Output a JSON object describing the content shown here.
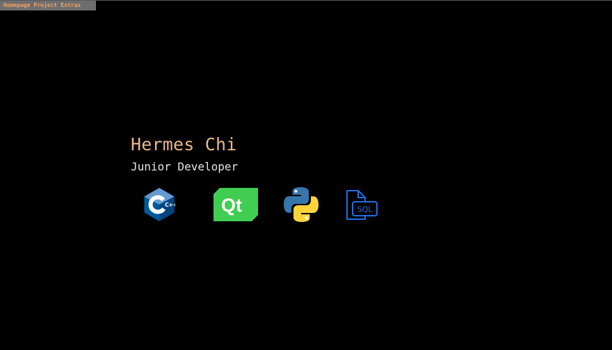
{
  "nav": {
    "items": [
      {
        "label": "Homepage"
      },
      {
        "label": "Project"
      },
      {
        "label": "Extras"
      }
    ]
  },
  "profile": {
    "name": "Hermes Chi",
    "role": "Junior Developer"
  },
  "skills": [
    {
      "icon": "cpp-icon",
      "text": "C++"
    },
    {
      "icon": "qt-icon",
      "text": "Qt"
    },
    {
      "icon": "python-icon",
      "text": ""
    },
    {
      "icon": "sql-file-icon",
      "text": "SQL"
    }
  ],
  "colors": {
    "background": "#000000",
    "nav_bar": "#6e6e6e",
    "nav_text": "#f0a35e",
    "name": "#e8b98c",
    "role": "#e6e6e6",
    "cpp": "#00599c",
    "qt": "#41cd52",
    "python_blue": "#3776ab",
    "python_yellow": "#ffd43b",
    "sql": "#1f6fe5"
  }
}
